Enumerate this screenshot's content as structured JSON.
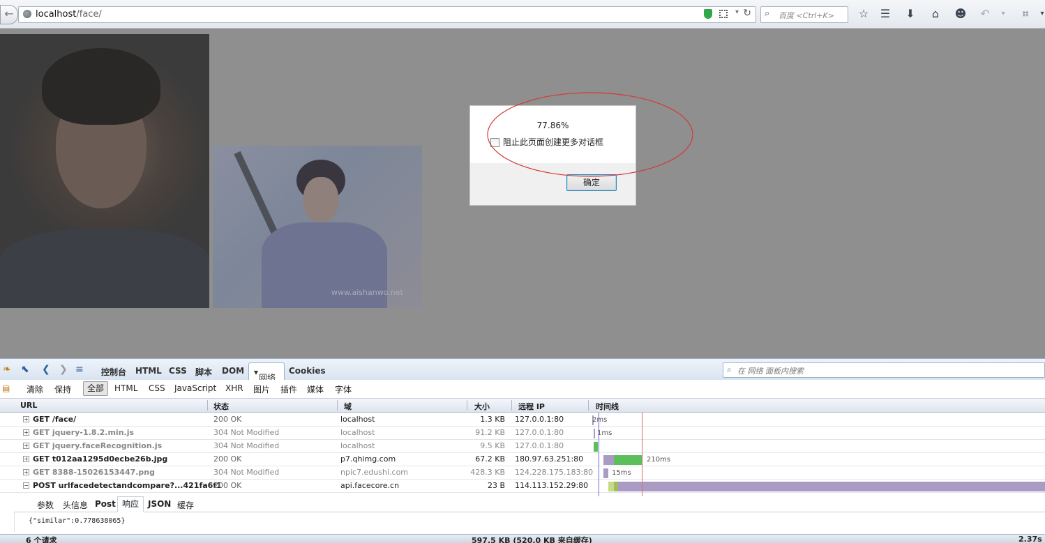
{
  "browser": {
    "url_host": "localhost",
    "url_path": "/face/",
    "search_placeholder": "百度 <Ctrl+K>"
  },
  "dialog": {
    "message": "77.86%",
    "checkbox_label": "阻止此页面创建更多对话框",
    "ok_label": "确定"
  },
  "photo2_watermark": "www.aishanwo.net",
  "firebug": {
    "tabs": [
      "控制台",
      "HTML",
      "CSS",
      "脚本",
      "DOM",
      "网络",
      "Cookies"
    ],
    "search_placeholder": "在 网络 面板内搜索",
    "filters": [
      "清除",
      "保持",
      "全部",
      "HTML",
      "CSS",
      "JavaScript",
      "XHR",
      "图片",
      "插件",
      "媒体",
      "字体"
    ],
    "columns": [
      "URL",
      "状态",
      "域",
      "大小",
      "远程 IP",
      "时间线"
    ],
    "requests": [
      {
        "url": "GET /face/",
        "status": "200 OK",
        "domain": "localhost",
        "size": "1.3 KB",
        "ip": "127.0.0.1:80",
        "time": "2ms",
        "expanded": false,
        "dim": false
      },
      {
        "url": "GET jquery-1.8.2.min.js",
        "status": "304 Not Modified",
        "domain": "localhost",
        "size": "91.2 KB",
        "ip": "127.0.0.1:80",
        "time": "1ms",
        "expanded": false,
        "dim": true
      },
      {
        "url": "GET jquery.faceRecognition.js",
        "status": "304 Not Modified",
        "domain": "localhost",
        "size": "9.5 KB",
        "ip": "127.0.0.1:80",
        "time": "",
        "expanded": false,
        "dim": true
      },
      {
        "url": "GET t012aa1295d0ecbe26b.jpg",
        "status": "200 OK",
        "domain": "p7.qhimg.com",
        "size": "67.2 KB",
        "ip": "180.97.63.251:80",
        "time": "210ms",
        "expanded": false,
        "dim": false
      },
      {
        "url": "GET 8388-15026153447.png",
        "status": "304 Not Modified",
        "domain": "npic7.edushi.com",
        "size": "428.3 KB",
        "ip": "124.228.175.183:80",
        "time": "15ms",
        "expanded": false,
        "dim": true
      },
      {
        "url": "POST urlfacedetectandcompare?...421fa6f1",
        "status": "200 OK",
        "domain": "api.facecore.cn",
        "size": "23 B",
        "ip": "114.113.152.29:80",
        "time": "",
        "expanded": true,
        "dim": false
      }
    ],
    "response_tabs": [
      "参数",
      "头信息",
      "Post",
      "响应",
      "JSON",
      "缓存"
    ],
    "response_text": "{\"similar\":0.778638065}",
    "status_left": "6 个请求",
    "status_mid": "597.5 KB   (520.0 KB 来自缓存)",
    "status_right": "2.37s"
  },
  "colors": {
    "accent_ellipse": "#d23a3a",
    "bar_green": "#5cbf5c",
    "bar_purple": "#a99bc3",
    "page_overlay": "#8f8f8f"
  }
}
